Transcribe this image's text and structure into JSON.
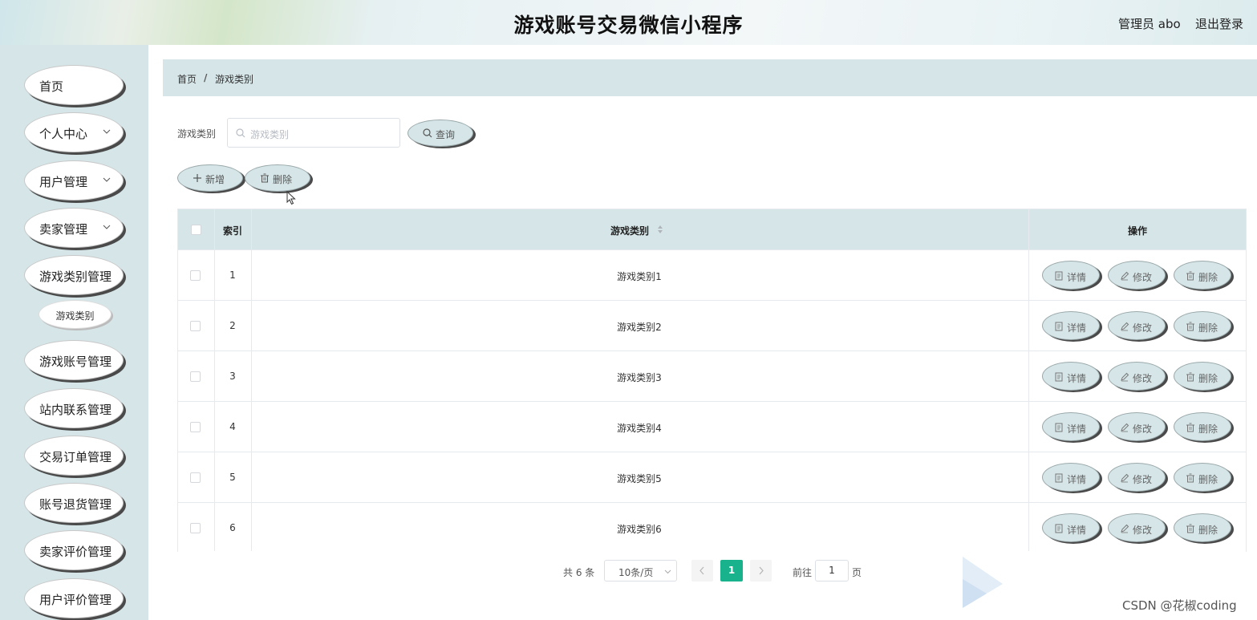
{
  "header": {
    "title": "游戏账号交易微信小程序",
    "admin": "管理员 abo",
    "logout": "退出登录"
  },
  "sidebar": {
    "items": [
      {
        "label": "首页",
        "icon": "",
        "expandable": false
      },
      {
        "label": "个人中心",
        "icon": "chevron-down-icon",
        "expandable": true
      },
      {
        "label": "用户管理",
        "icon": "chevron-down-icon",
        "expandable": true
      },
      {
        "label": "卖家管理",
        "icon": "chevron-down-icon",
        "expandable": true
      },
      {
        "label": "游戏类别管理",
        "icon": "",
        "expandable": false
      },
      {
        "label": "游戏账号管理",
        "icon": "",
        "expandable": false
      },
      {
        "label": "站内联系管理",
        "icon": "",
        "expandable": false
      },
      {
        "label": "交易订单管理",
        "icon": "",
        "expandable": false
      },
      {
        "label": "账号退货管理",
        "icon": "",
        "expandable": false
      },
      {
        "label": "卖家评价管理",
        "icon": "",
        "expandable": false
      },
      {
        "label": "用户评价管理",
        "icon": "",
        "expandable": false
      }
    ],
    "sub_item": "游戏类别"
  },
  "breadcrumb": {
    "home": "首页",
    "separator": "/",
    "current": "游戏类别"
  },
  "search": {
    "label": "游戏类别",
    "placeholder": "游戏类别",
    "value": "",
    "query_button": "查询",
    "icon": "search-icon"
  },
  "toolbar": {
    "add_button": "新增",
    "delete_button": "删除",
    "add_icon": "plus-icon",
    "delete_icon": "trash-icon"
  },
  "table": {
    "headers": {
      "index": "索引",
      "name": "游戏类别",
      "actions": "操作"
    },
    "rows": [
      {
        "index": "1",
        "name": "游戏类别1"
      },
      {
        "index": "2",
        "name": "游戏类别2"
      },
      {
        "index": "3",
        "name": "游戏类别3"
      },
      {
        "index": "4",
        "name": "游戏类别4"
      },
      {
        "index": "5",
        "name": "游戏类别5"
      },
      {
        "index": "6",
        "name": "游戏类别6"
      }
    ],
    "row_actions": {
      "detail": "详情",
      "edit": "修改",
      "delete": "删除"
    }
  },
  "pagination": {
    "total": "共 6 条",
    "page_size": "10条/页",
    "current_page": "1",
    "goto_label": "前往",
    "goto_value": "1",
    "page_suffix": "页"
  },
  "watermark": "CSDN @花椒coding",
  "colors": {
    "accent_light": "#d6e6e8",
    "active_page": "#18b28c",
    "pill_shadow": "#4a4a4a"
  }
}
